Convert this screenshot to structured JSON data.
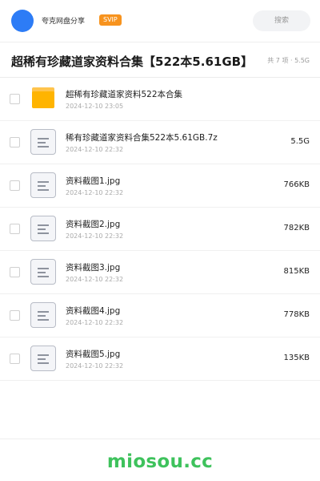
{
  "header": {
    "brand": "夸克网盘分享",
    "badge": "SVIP",
    "search_placeholder": "搜索"
  },
  "share": {
    "title": "超稀有珍藏道家资料合集【522本5.61GB】",
    "summary": "共 7 项 · 5.5G"
  },
  "files": [
    {
      "type": "folder",
      "name": "超稀有珍藏道家资料522本合集",
      "date": "2024-12-10 23:05",
      "size": ""
    },
    {
      "type": "file",
      "name": "稀有珍藏道家资料合集522本5.61GB.7z",
      "date": "2024-12-10 22:32",
      "size": "5.5G"
    },
    {
      "type": "file",
      "name": "资料截图1.jpg",
      "date": "2024-12-10 22:32",
      "size": "766KB"
    },
    {
      "type": "file",
      "name": "资料截图2.jpg",
      "date": "2024-12-10 22:32",
      "size": "782KB"
    },
    {
      "type": "file",
      "name": "资料截图3.jpg",
      "date": "2024-12-10 22:32",
      "size": "815KB"
    },
    {
      "type": "file",
      "name": "资料截图4.jpg",
      "date": "2024-12-10 22:32",
      "size": "778KB"
    },
    {
      "type": "file",
      "name": "资料截图5.jpg",
      "date": "2024-12-10 22:32",
      "size": "135KB"
    }
  ],
  "watermark": "miosou.cc",
  "colors": {
    "accent": "#2d7cf6",
    "badge": "#f7931e",
    "folder": "#ffb400",
    "watermark": "#3ec25c"
  }
}
